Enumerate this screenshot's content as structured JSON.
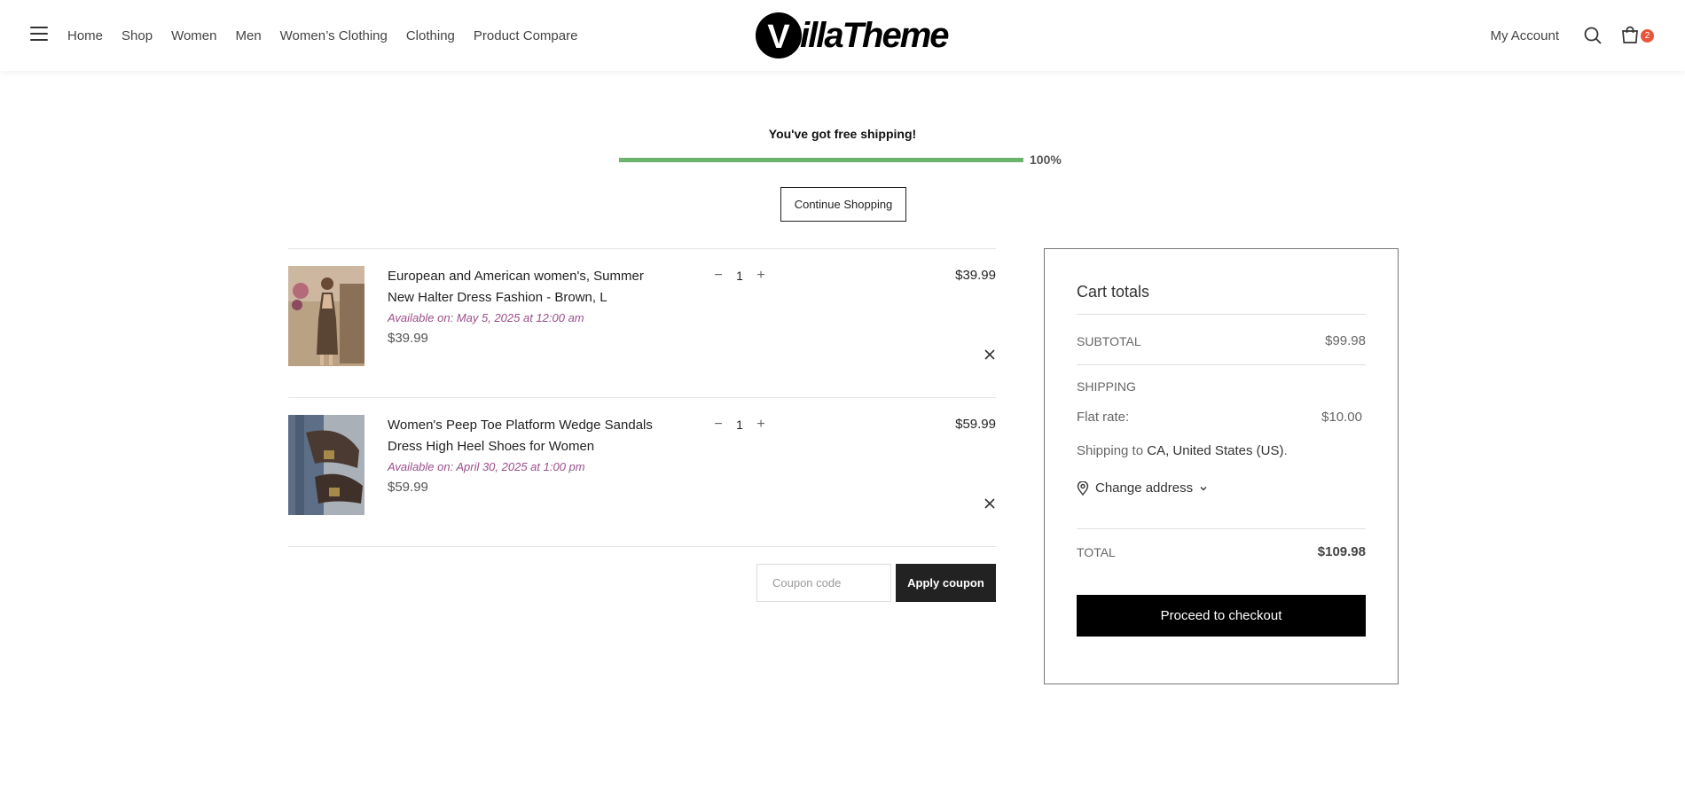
{
  "header": {
    "nav": [
      "Home",
      "Shop",
      "Women",
      "Men",
      "Women’s Clothing",
      "Clothing",
      "Product Compare"
    ],
    "logo_letter": "V",
    "logo_text": "illaTheme",
    "my_account": "My Account",
    "cart_count": "2"
  },
  "shipping_bar": {
    "message": "You've got free shipping!",
    "progress": 100,
    "progress_label": "100%",
    "bar_color": "#6ab56c",
    "continue_label": "Continue Shopping"
  },
  "cart": {
    "items": [
      {
        "name": "European and American women's, Summer New Halter Dress Fashion - Brown, L",
        "available": "Available on: May 5, 2025 at 12:00 am",
        "price": "$39.99",
        "qty": "1",
        "subtotal": "$39.99"
      },
      {
        "name": "Women's Peep Toe Platform Wedge Sandals Dress High Heel Shoes for Women",
        "available": "Available on: April 30, 2025 at 1:00 pm",
        "price": "$59.99",
        "qty": "1",
        "subtotal": "$59.99"
      }
    ],
    "coupon_placeholder": "Coupon code",
    "apply_label": "Apply coupon"
  },
  "totals": {
    "title": "Cart totals",
    "subtotal_label": "SUBTOTAL",
    "subtotal_value": "$99.98",
    "shipping_label": "SHIPPING",
    "flat_rate_label": "Flat rate:",
    "flat_rate_value": "$10.00",
    "ship_to_prefix": "Shipping to",
    "ship_to_location": "CA, United States (US)",
    "ship_to_suffix": ".",
    "change_address": "Change address",
    "total_label": "TOTAL",
    "total_value": "$109.98",
    "checkout_label": "Proceed to checkout"
  },
  "colors": {
    "accent_badge": "#e8553a",
    "availability_text": "#9b4e8a"
  }
}
